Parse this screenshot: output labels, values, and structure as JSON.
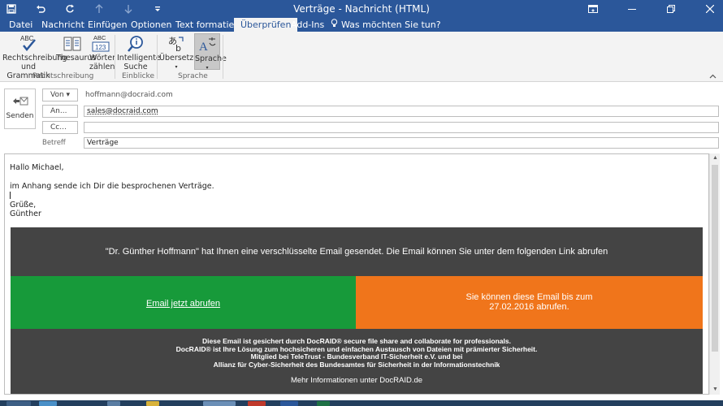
{
  "window": {
    "title": "Verträge - Nachricht (HTML)"
  },
  "tabs": [
    "Datei",
    "Nachricht",
    "Einfügen",
    "Optionen",
    "Text formatieren",
    "Überprüfen",
    "Add-Ins",
    "Was möchten Sie tun?"
  ],
  "active_tab": "Überprüfen",
  "ribbon": {
    "buttons": {
      "spelling_line1": "Rechtschreibung",
      "spelling_line2": "und Grammatik",
      "thesaurus": "Thesaurus",
      "wordcount_line1": "Wörter",
      "wordcount_line2": "zählen",
      "smartlookup_line1": "Intelligente",
      "smartlookup_line2": "Suche",
      "translate": "Übersetzen",
      "language": "Sprache"
    },
    "groups": {
      "proofing": "Rechtschreibung",
      "insights": "Einblicke",
      "language": "Sprache"
    },
    "icon_text": {
      "abc": "ABC",
      "abc123_top": "ABC",
      "abc123_bottom": "123"
    }
  },
  "header": {
    "send_label": "Senden",
    "from_button": "Von ▾",
    "from_value": "hoffmann@docraid.com",
    "to_button": "An...",
    "to_value": "sales@docraid.com",
    "cc_button": "Cc...",
    "cc_value": "",
    "subject_label": "Betreff",
    "subject_value": "Verträge"
  },
  "message": {
    "greeting": "Hallo Michael,",
    "line1": "im Anhang sende ich Dir die besprochenen Verträge.",
    "closing1": "Grüße,",
    "closing2": "Günther",
    "banner_text_before": "\"Dr. Günther Hoffmann\" hat Ihnen eine verschlüsselte Email gesendet. Die ",
    "banner_email_link": "Email",
    "banner_text_middle": " können Sie unter dem folgenden ",
    "banner_link_word": "Link",
    "banner_text_after": " abrufen",
    "green_link": "Email jetzt abrufen",
    "orange_line1": "Sie können diese Email bis zum",
    "orange_line2": "27.02.2016 abrufen.",
    "footer_line1": "Diese Email ist gesichert durch DocRAID® secure file share and collaborate for professionals.",
    "footer_line2": "DocRAID® ist Ihre Lösung zum hochsicheren und einfachen Austausch von Dateien mit prämierter Sicherheit.",
    "footer_line3": "Mitglied bei TeleTrust - Bundesverband IT-Sicherheit e.V. und bei",
    "footer_line4": "Allianz für Cyber-Sicherheit des Bundesamtes für Sicherheit in der Informationstechnik",
    "more_info_prefix": "Mehr Informationen unter ",
    "more_info_link": "DocRAID.de"
  },
  "colors": {
    "titlebar": "#2b579a",
    "banner_gray": "#444444",
    "green": "#179a3a",
    "orange": "#f0751b"
  }
}
